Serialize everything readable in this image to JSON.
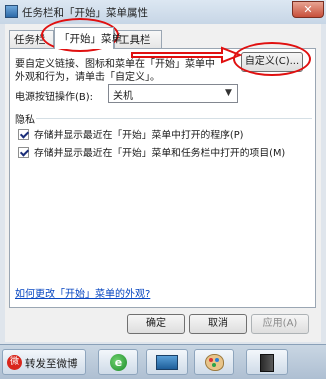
{
  "window": {
    "title": "任务栏和「开始」菜单属性",
    "close_label": "✕"
  },
  "tabs": [
    {
      "label": "任务栏"
    },
    {
      "label": "「开始」菜单"
    },
    {
      "label": "工具栏"
    }
  ],
  "start_menu": {
    "description_line1": "要自定义链接、图标和菜单在「开始」菜单中",
    "description_line2": "外观和行为，请单击「自定义」。",
    "customize_button": "自定义(C)...",
    "power_label": "电源按钮操作(B):",
    "power_value": "关机",
    "privacy_title": "隐私",
    "privacy_options": [
      {
        "label": "存储并显示最近在「开始」菜单中打开的程序(P)",
        "checked": true
      },
      {
        "label": "存储并显示最近在「开始」菜单和任务栏中打开的项目(M)",
        "checked": true
      }
    ],
    "help_link": "如何更改「开始」菜单的外观?"
  },
  "dialog_buttons": {
    "ok": "确定",
    "cancel": "取消",
    "apply": "应用(A)"
  },
  "taskbar": {
    "items": [
      {
        "label": "转发至微博",
        "icon": "weibo-icon"
      },
      {
        "label": "",
        "icon": "ie-icon"
      },
      {
        "label": "",
        "icon": "explorer-icon"
      },
      {
        "label": "",
        "icon": "paint-icon"
      },
      {
        "label": "",
        "icon": "computer-icon"
      }
    ]
  },
  "annotation_color": "#e01010"
}
